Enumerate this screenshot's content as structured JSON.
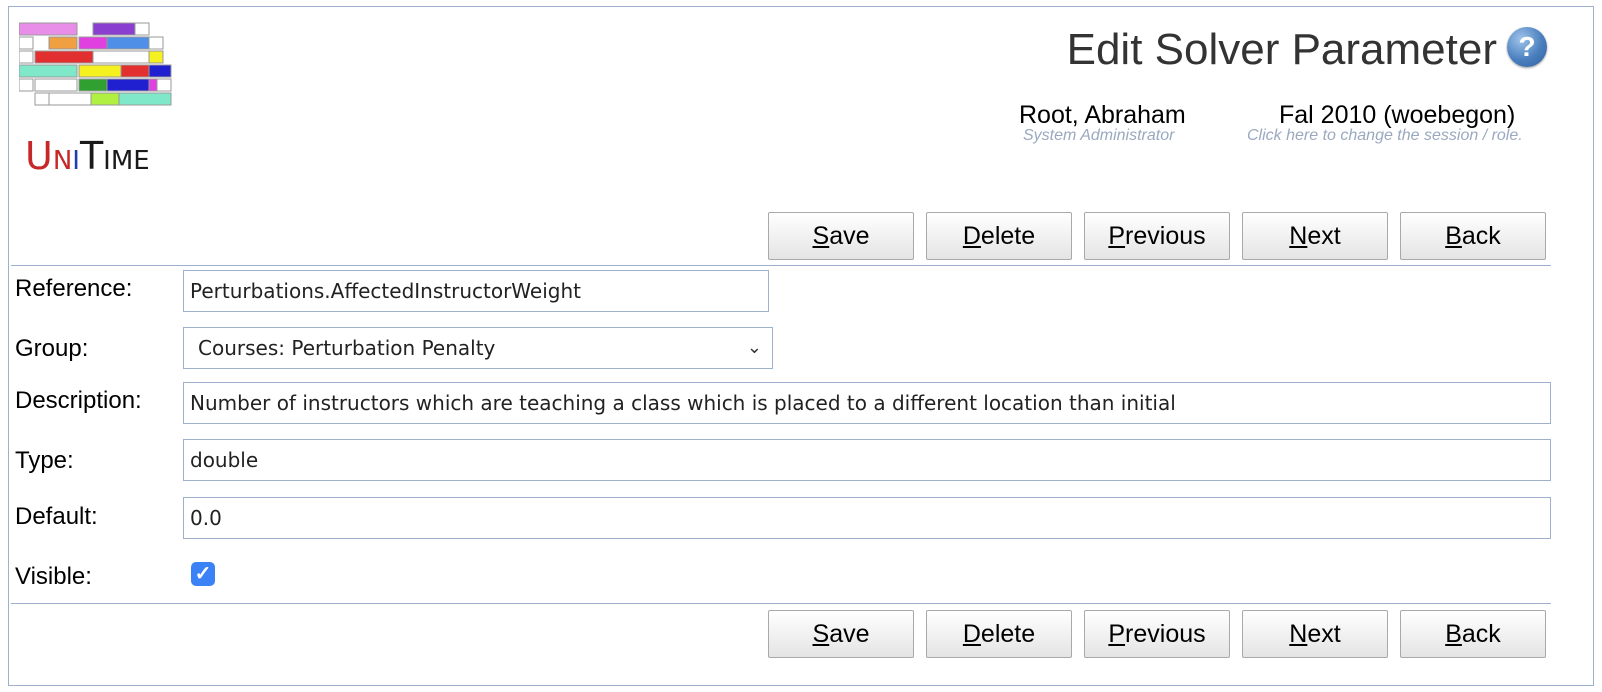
{
  "app": {
    "logo_text": "UniTime",
    "page_title": "Edit Solver Parameter"
  },
  "header": {
    "user_name": "Root, Abraham",
    "user_role": "System Administrator",
    "session": "Fal 2010 (woebegon)",
    "session_hint": "Click here to change the session / role."
  },
  "buttons": {
    "save": {
      "acc": "S",
      "rest": "ave"
    },
    "delete": {
      "acc": "D",
      "rest": "elete"
    },
    "previous": {
      "acc": "P",
      "rest": "revious"
    },
    "next": {
      "acc": "N",
      "rest": "ext"
    },
    "back": {
      "acc": "B",
      "rest": "ack"
    }
  },
  "form": {
    "reference": {
      "label": "Reference:",
      "value": "Perturbations.AffectedInstructorWeight"
    },
    "group": {
      "label": "Group:",
      "value": "Courses: Perturbation Penalty"
    },
    "description": {
      "label": "Description:",
      "value": "Number of instructors which are teaching a class which is placed to a different location than initial"
    },
    "type": {
      "label": "Type:",
      "value": "double"
    },
    "default": {
      "label": "Default:",
      "value": "0.0"
    },
    "visible": {
      "label": "Visible:",
      "checked": true
    }
  },
  "icons": {
    "help": "help-icon",
    "dropdown": "chevron-down-icon",
    "checkbox": "checkmark-icon"
  },
  "colors": {
    "border": "#9fb0cc",
    "hint_text": "#9aa9bf",
    "checkbox": "#3b82f6"
  }
}
